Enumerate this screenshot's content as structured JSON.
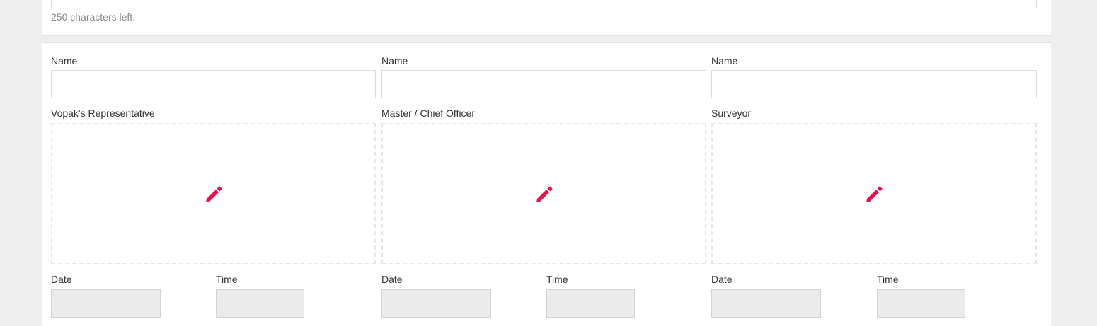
{
  "remarks": {
    "chars_left": "250 characters left."
  },
  "accent_color": "#e8114a",
  "signatures": [
    {
      "name_label": "Name",
      "name_value": "",
      "role_label": "Vopak's Representative",
      "pad_icon": "pencil-icon",
      "date_label": "Date",
      "date_value": "",
      "time_label": "Time",
      "time_value": ""
    },
    {
      "name_label": "Name",
      "name_value": "",
      "role_label": "Master / Chief Officer",
      "pad_icon": "pencil-icon",
      "date_label": "Date",
      "date_value": "",
      "time_label": "Time",
      "time_value": ""
    },
    {
      "name_label": "Name",
      "name_value": "",
      "role_label": "Surveyor",
      "pad_icon": "pencil-icon",
      "date_label": "Date",
      "date_value": "",
      "time_label": "Time",
      "time_value": ""
    }
  ]
}
